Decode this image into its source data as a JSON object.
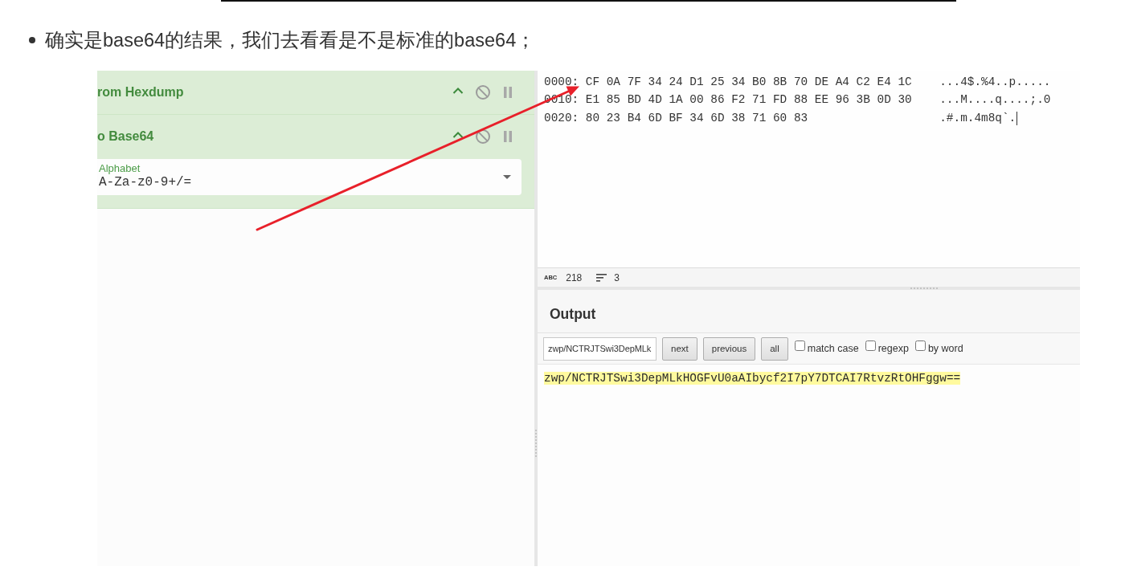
{
  "article": {
    "bullet_items": [
      {
        "text": "确实是base64的结果，我们去看看是不是标准的base64；"
      }
    ]
  },
  "screenshot": {
    "recipe": {
      "operations": [
        {
          "title": "rom Hexdump"
        },
        {
          "title": "o Base64",
          "args": [
            {
              "kind": "dropdown",
              "label": "Alphabet",
              "value": "A-Za-z0-9+/="
            }
          ]
        }
      ]
    },
    "input": {
      "lines": [
        {
          "hex": "0000: CF 0A 7F 34 24 D1 25 34 B0 8B 70 DE A4 C2 E4 1C",
          "ascii": "...4$.%4..p....."
        },
        {
          "hex": "0010: E1 85 BD 4D 1A 00 86 F2 71 FD 88 EE 96 3B 0D 30",
          "ascii": "...M....q....;.0"
        },
        {
          "hex": "0020: 80 23 B4 6D BF 34 6D 38 71 60 83",
          "ascii": ".#.m.4m8q`."
        }
      ],
      "caret": true
    },
    "input_stats": {
      "length_label": "ABC",
      "length": "218",
      "lines": "3"
    },
    "output": {
      "title": "Output",
      "search": {
        "value": "zwp/NCTRJTSwi3DepMLk",
        "buttons": [
          "next",
          "previous",
          "all"
        ],
        "options": [
          {
            "label": "match case",
            "checked": false
          },
          {
            "label": "regexp",
            "checked": false
          },
          {
            "label": "by word",
            "checked": false
          }
        ]
      },
      "result": {
        "text": "zwp/NCTRJTSwi3DepMLkHOGFvU0aAIbycf2I7pY7DTCAI7RtvzRtOHFggw==",
        "highlighted": true
      }
    }
  },
  "annotations": [
    {
      "kind": "arrow"
    }
  ]
}
